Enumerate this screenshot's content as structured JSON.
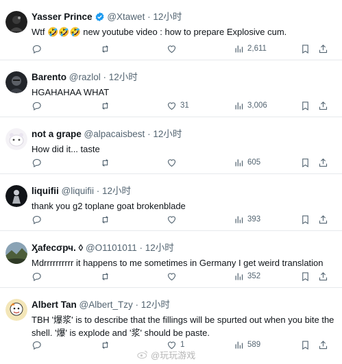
{
  "tweets": [
    {
      "name": "Yasser Prince",
      "verified": true,
      "handle": "@Xtawet",
      "dot": "·",
      "time": "12小时",
      "text": "Wtf 🤣🤣🤣 new youtube video : how to prepare Explosive cum.",
      "likes": "",
      "views": "2,611",
      "avatar_icon": "dark-glow-avatar"
    },
    {
      "name": "Barento",
      "verified": false,
      "handle": "@razlol",
      "dot": "·",
      "time": "12小时",
      "text": "HGAHAHAA WHAT",
      "likes": "31",
      "views": "3,006",
      "avatar_icon": "dark-face-avatar"
    },
    {
      "name": "not a grape",
      "verified": false,
      "handle": "@alpacaisbest",
      "dot": "·",
      "time": "12小时",
      "text": "How did it... taste",
      "likes": "",
      "views": "605",
      "avatar_icon": "cute-white-avatar"
    },
    {
      "name": "liquifii",
      "verified": false,
      "handle": "@liquifii",
      "dot": "·",
      "time": "12小时",
      "text": "thank you g2 toplane goat brokenblade",
      "likes": "",
      "views": "393",
      "avatar_icon": "dark-figure-avatar"
    },
    {
      "name": "Ӽafeϲσрч. ◊",
      "verified": false,
      "handle": "@O1101011",
      "dot": "·",
      "time": "12小时",
      "text": "Mdrrrrrrrrrr it happens to me sometimes in Germany I get weird translation",
      "likes": "",
      "views": "352",
      "avatar_icon": "landscape-avatar"
    },
    {
      "name": "Albert Tan",
      "verified": false,
      "handle": "@Albert_Tzy",
      "dot": "·",
      "time": "12小时",
      "text": "TBH '爆浆' is to describe that the fillings will be spurted out when you bite the shell. '爆' is explode and '浆' should be paste.",
      "likes": "1",
      "views": "589",
      "avatar_icon": "cartoon-avatar"
    }
  ],
  "watermark": {
    "text": "@玩玩游戏",
    "icon": "weibo-icon"
  },
  "colors": {
    "text": "#0f1419",
    "muted": "#536471",
    "verified": "#1d9bf0",
    "divider": "#e6e9ec"
  }
}
